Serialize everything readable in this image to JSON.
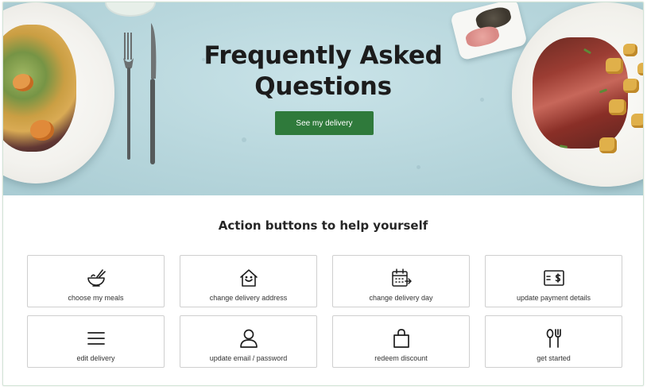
{
  "hero": {
    "title_line1": "Frequently Asked",
    "title_line2": "Questions",
    "cta_label": "See my delivery",
    "cta_color": "#2f7a3b"
  },
  "actions": {
    "heading": "Action buttons to help yourself",
    "items": [
      {
        "label": "choose my meals",
        "icon": "bowl-chopsticks-icon"
      },
      {
        "label": "change delivery address",
        "icon": "house-smile-icon"
      },
      {
        "label": "change delivery day",
        "icon": "calendar-arrow-icon"
      },
      {
        "label": "update payment details",
        "icon": "payment-card-dollar-icon"
      },
      {
        "label": "edit delivery",
        "icon": "menu-lines-icon"
      },
      {
        "label": "update email / password",
        "icon": "user-icon"
      },
      {
        "label": "redeem discount",
        "icon": "shopping-bag-icon"
      },
      {
        "label": "get started",
        "icon": "spoon-fork-icon"
      }
    ]
  }
}
